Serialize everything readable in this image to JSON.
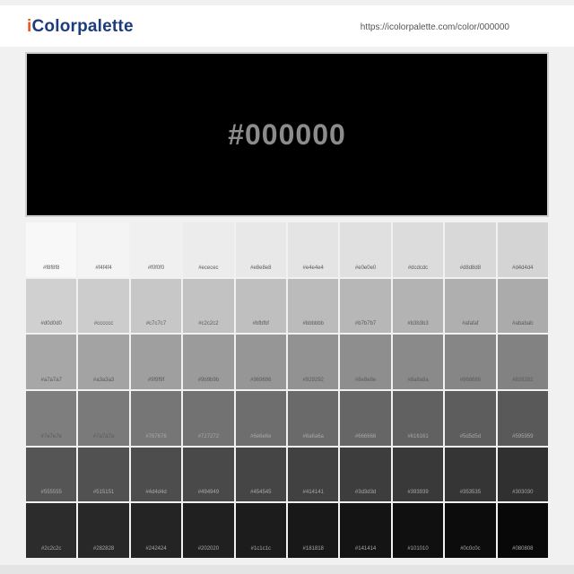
{
  "header": {
    "logo_i": "i",
    "logo_rest": "Colorpalette",
    "url": "https://icolorpalette.com/color/000000"
  },
  "hero": {
    "hex": "#000000",
    "color": "#000000"
  },
  "shades": [
    [
      "#f8f8f8",
      "#f4f4f4",
      "#f0f0f0",
      "#ececec",
      "#e8e8e8",
      "#e4e4e4",
      "#e0e0e0",
      "#dcdcdc",
      "#d8d8d8",
      "#d4d4d4"
    ],
    [
      "#d0d0d0",
      "#cccccc",
      "#c7c7c7",
      "#c2c2c2",
      "#bfbfbf",
      "#bbbbbb",
      "#b7b7b7",
      "#b3b3b3",
      "#afafaf",
      "#ababab"
    ],
    [
      "#a7a7a7",
      "#a3a3a3",
      "#9f9f9f",
      "#9b9b9b",
      "#969696",
      "#929292",
      "#8e8e8e",
      "#8a8a8a",
      "#868686",
      "#828282"
    ],
    [
      "#7e7e7e",
      "#7a7a7a",
      "#767676",
      "#727272",
      "#6e6e6e",
      "#6a6a6a",
      "#666666",
      "#616161",
      "#5d5d5d",
      "#595959"
    ],
    [
      "#555555",
      "#515151",
      "#4d4d4d",
      "#494949",
      "#454545",
      "#414141",
      "#3d3d3d",
      "#393939",
      "#353535",
      "#303030"
    ],
    [
      "#2c2c2c",
      "#282828",
      "#242424",
      "#202020",
      "#1c1c1c",
      "#181818",
      "#141414",
      "#101010",
      "#0c0c0c",
      "#080808"
    ]
  ]
}
